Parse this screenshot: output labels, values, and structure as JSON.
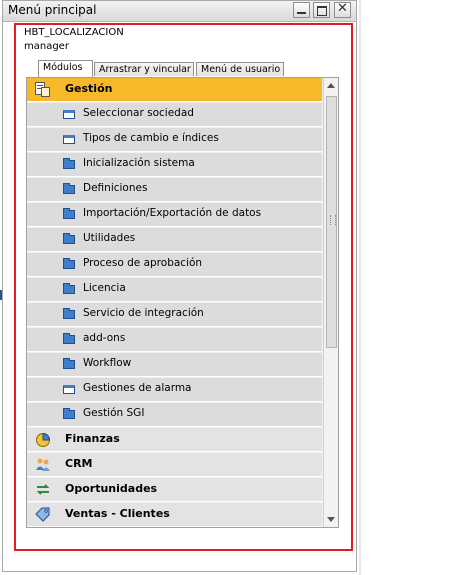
{
  "window": {
    "title": "Menú principal"
  },
  "header": {
    "company": "HBT_LOCALIZACION",
    "user": "manager"
  },
  "tabs": [
    {
      "label": "Módulos",
      "active": true
    },
    {
      "label": "Arrastrar y vincular",
      "active": false
    },
    {
      "label": "Menú de usuario",
      "active": false
    }
  ],
  "menu": {
    "gestion": "Gestión",
    "items": [
      "Seleccionar sociedad",
      "Tipos de cambio e índices",
      "Inicialización sistema",
      "Definiciones",
      "Importación/Exportación de datos",
      "Utilidades",
      "Proceso de aprobación",
      "Licencia",
      "Servicio de integración",
      "add-ons",
      "Workflow",
      "Gestiones de alarma",
      "Gestión SGI"
    ],
    "finanzas": "Finanzas",
    "crm": "CRM",
    "oportunidades": "Oportunidades",
    "ventas": "Ventas - Clientes"
  },
  "colors": {
    "selected_row": "#f7b82a",
    "highlight_border": "#e01b24",
    "icon_blue": "#3e7fc7"
  }
}
